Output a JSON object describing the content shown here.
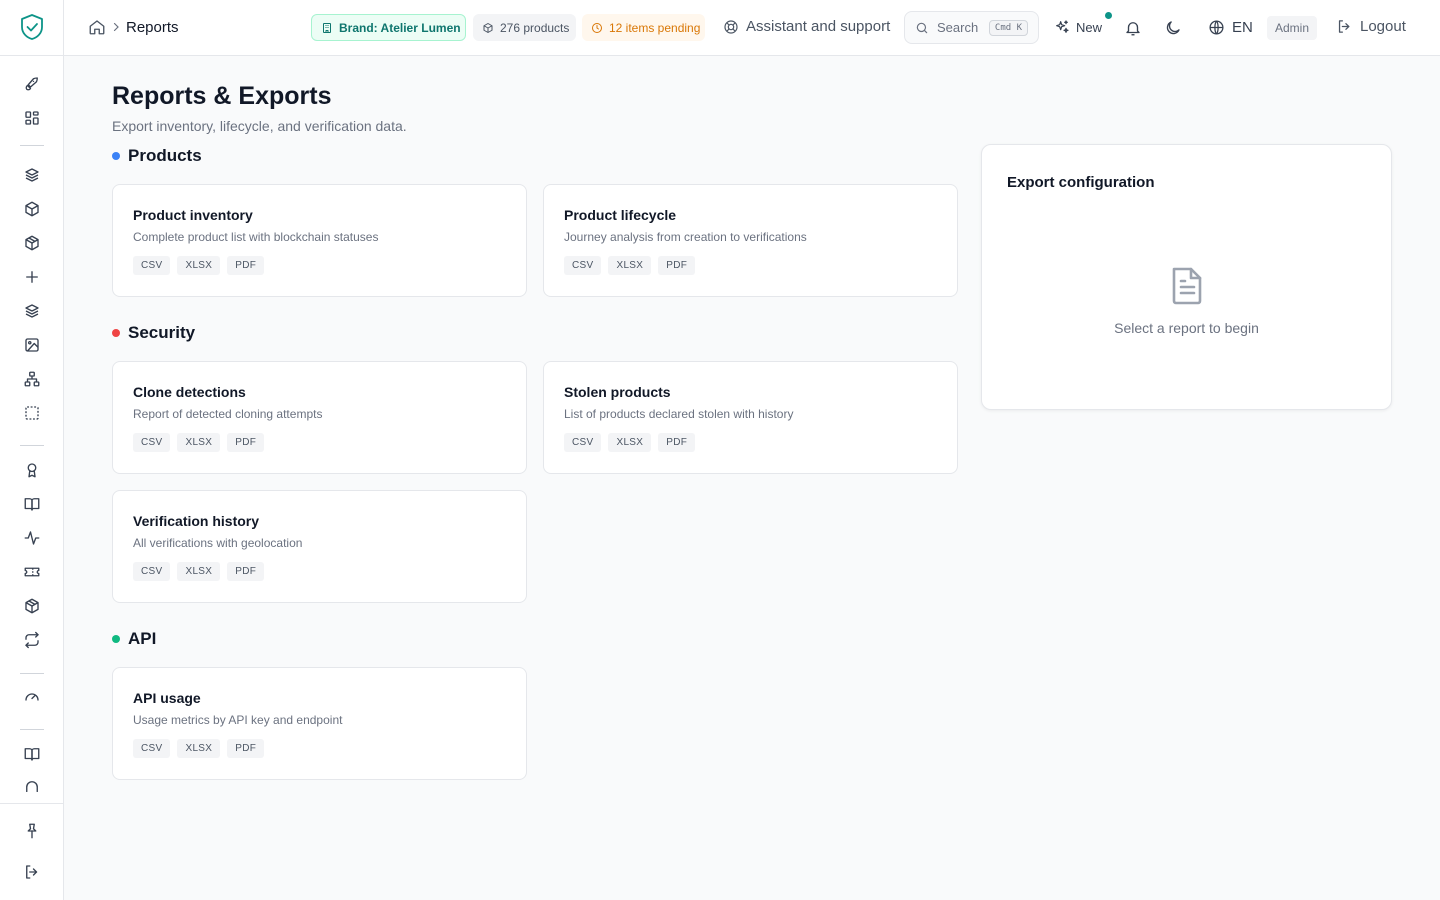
{
  "topbar": {
    "breadcrumb_page": "Reports",
    "brand_chip": "Brand: Atelier Lumen",
    "products_chip": "276 products",
    "pending_chip": "12 items pending",
    "assistant": "Assistant and support",
    "search_placeholder": "Search",
    "search_kbd": "Cmd K",
    "new_label": "New",
    "language": "EN",
    "role": "Admin",
    "logout": "Logout"
  },
  "page": {
    "title": "Reports & Exports",
    "subtitle": "Export inventory, lifecycle, and verification data."
  },
  "sections": {
    "products": "Products",
    "security": "Security",
    "api": "API"
  },
  "reports": {
    "product_inventory": {
      "title": "Product inventory",
      "desc": "Complete product list with blockchain statuses"
    },
    "product_lifecycle": {
      "title": "Product lifecycle",
      "desc": "Journey analysis from creation to verifications"
    },
    "clone_detections": {
      "title": "Clone detections",
      "desc": "Report of detected cloning attempts"
    },
    "stolen_products": {
      "title": "Stolen products",
      "desc": "List of products declared stolen with history"
    },
    "verification_history": {
      "title": "Verification history",
      "desc": "All verifications with geolocation"
    },
    "api_usage": {
      "title": "API usage",
      "desc": "Usage metrics by API key and endpoint"
    }
  },
  "formats": {
    "csv": "CSV",
    "xlsx": "XLSX",
    "pdf": "PDF"
  },
  "config": {
    "title": "Export configuration",
    "empty": "Select a report to begin"
  },
  "colors": {
    "products_dot": "#3b82f6",
    "security_dot": "#ef4444",
    "api_dot": "#10b981",
    "accent": "#0d9488"
  }
}
